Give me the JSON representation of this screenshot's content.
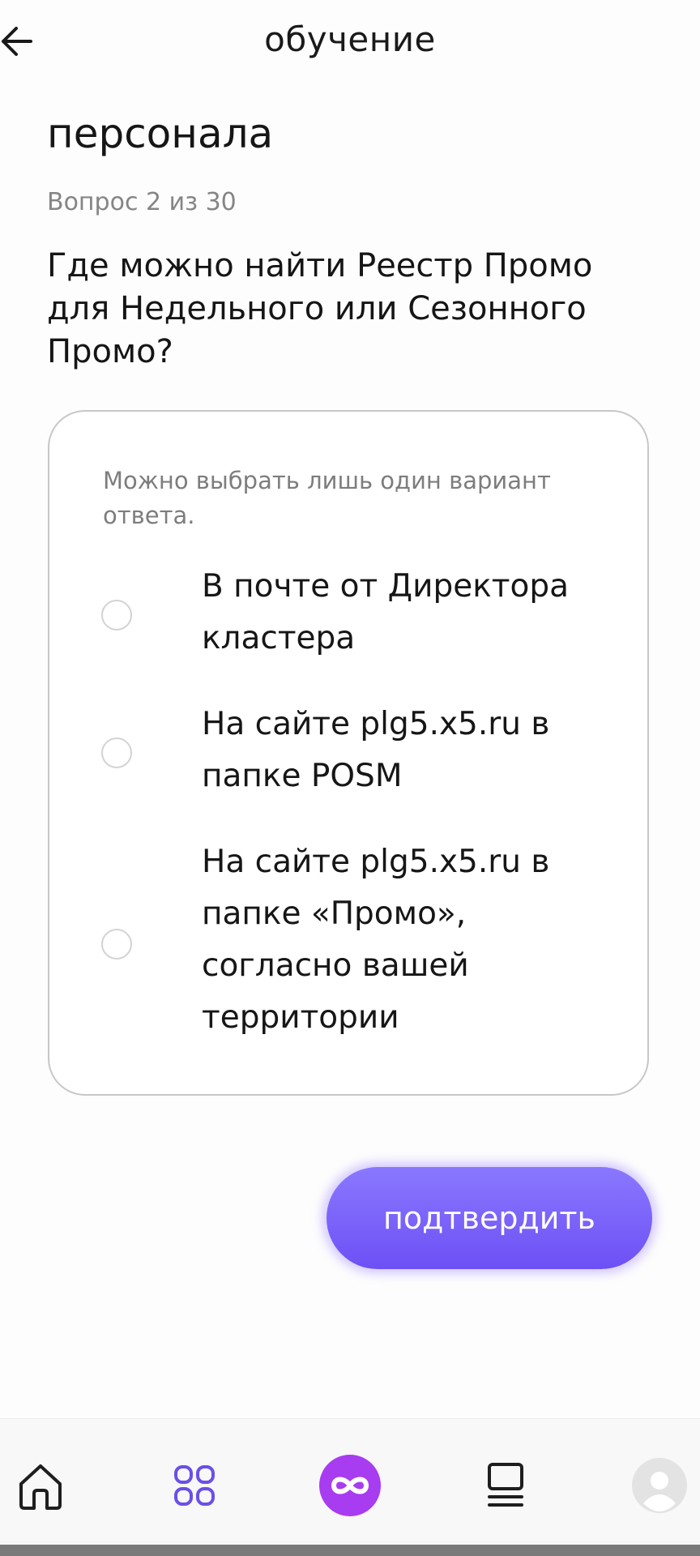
{
  "header": {
    "title": "обучение",
    "back_icon": "arrow-left-icon"
  },
  "course": {
    "title": "персонала"
  },
  "question": {
    "counter": "Вопрос 2 из 30",
    "text": "Где можно найти Реестр Промо для Недельного или Сезонного Промо?",
    "hint": "Можно выбрать лишь один вариант ответа.",
    "options": [
      {
        "label": "В почте от Директора кластера",
        "selected": false
      },
      {
        "label": "На сайте plg5.x5.ru в папке POSM",
        "selected": false
      },
      {
        "label": "На сайте plg5.x5.ru в папке «Промо», согласно вашей территории",
        "selected": false
      }
    ]
  },
  "actions": {
    "confirm_label": "подтвердить"
  },
  "bottom_nav": {
    "items": [
      {
        "icon": "home-icon"
      },
      {
        "icon": "grid-apps-icon"
      },
      {
        "icon": "infinity-icon"
      },
      {
        "icon": "stack-list-icon"
      },
      {
        "icon": "user-avatar-icon"
      }
    ]
  },
  "colors": {
    "accent": "#7b62ff",
    "nav_accent": "#6b4fe8",
    "infinity_bg": "#a83cf0"
  }
}
